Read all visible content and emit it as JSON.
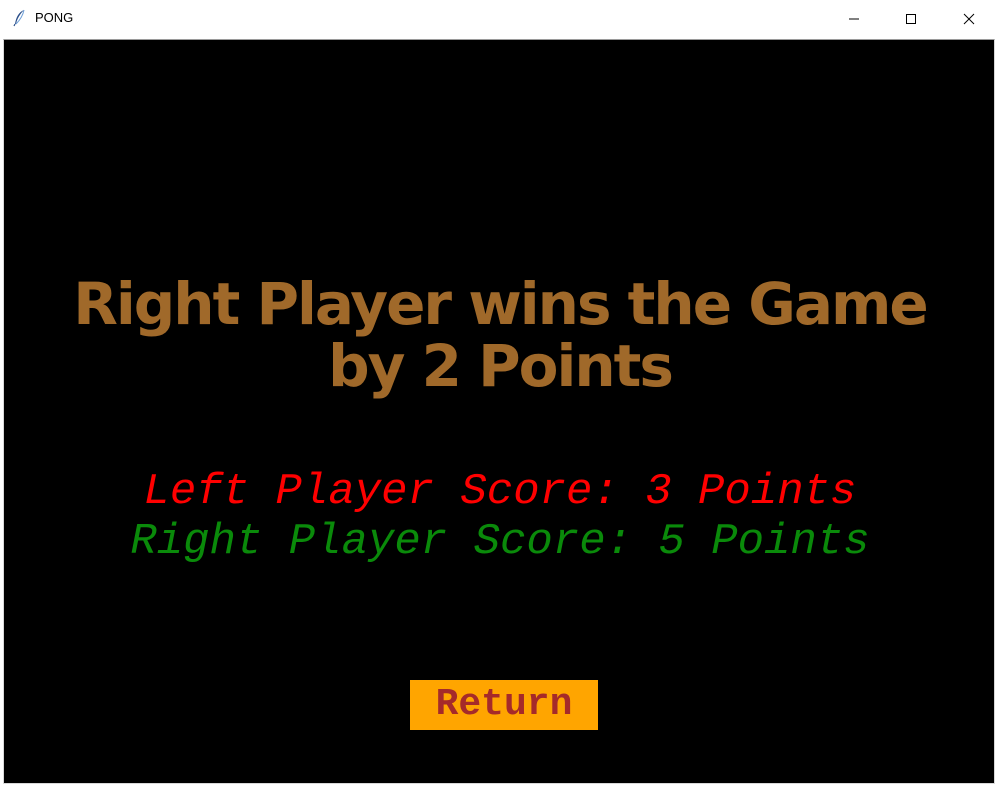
{
  "window": {
    "title": "PONG",
    "app_icon": "feather-icon",
    "controls": [
      "minimize-icon",
      "maximize-icon",
      "close-icon"
    ]
  },
  "game": {
    "result_line1": "Right Player wins the Game",
    "result_line2": "by 2 Points",
    "left_score_text": "Left Player Score: 3 Points",
    "right_score_text": "Right Player Score: 5 Points",
    "left_score": 3,
    "right_score": 5,
    "return_label": "Return"
  },
  "colors": {
    "background": "#000000",
    "headline": "#a0692a",
    "left_player": "#ff0000",
    "right_player": "#0a8a0a",
    "button_bg": "#ffa500",
    "button_text": "#a52a2a"
  }
}
